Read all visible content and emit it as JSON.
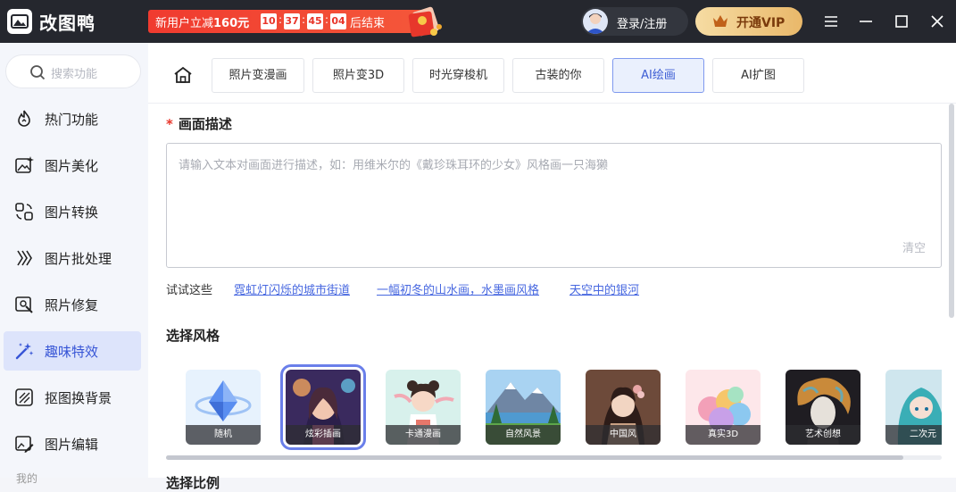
{
  "app": {
    "title": "改图鸭"
  },
  "promo": {
    "prefix": "新用户立减",
    "amount": "160元",
    "countdown": [
      "10",
      "37",
      "45",
      "04"
    ],
    "suffix": "后结束"
  },
  "header": {
    "login_label": "登录/注册",
    "vip_label": "开通VIP"
  },
  "sidebar": {
    "search_placeholder": "搜索功能",
    "items": [
      {
        "label": "热门功能",
        "icon": "flame-icon"
      },
      {
        "label": "图片美化",
        "icon": "image-sparkle-icon"
      },
      {
        "label": "图片转换",
        "icon": "convert-icon"
      },
      {
        "label": "图片批处理",
        "icon": "batch-icon"
      },
      {
        "label": "照片修复",
        "icon": "photo-repair-icon"
      },
      {
        "label": "趣味特效",
        "icon": "magic-wand-icon",
        "active": true
      },
      {
        "label": "抠图换背景",
        "icon": "cutout-icon"
      },
      {
        "label": "图片编辑",
        "icon": "image-edit-icon"
      }
    ],
    "section_label": "我的"
  },
  "tabs": [
    {
      "label": "照片变漫画"
    },
    {
      "label": "照片变3D"
    },
    {
      "label": "时光穿梭机"
    },
    {
      "label": "古装的你"
    },
    {
      "label": "AI绘画",
      "active": true
    },
    {
      "label": "AI扩图"
    }
  ],
  "description": {
    "required_mark": "*",
    "title": "画面描述",
    "placeholder": "请输入文本对画面进行描述，如：用维米尔的《戴珍珠耳环的少女》风格画一只海獭",
    "clear_label": "清空"
  },
  "suggestions": {
    "label": "试试这些",
    "items": [
      "霓虹灯闪烁的城市街道",
      "一幅初冬的山水画，水墨画风格",
      "天空中的银河"
    ]
  },
  "styles": {
    "title": "选择风格",
    "items": [
      {
        "label": "随机"
      },
      {
        "label": "炫彩插画",
        "selected": true
      },
      {
        "label": "卡通漫画"
      },
      {
        "label": "自然风景"
      },
      {
        "label": "中国风"
      },
      {
        "label": "真实3D"
      },
      {
        "label": "艺术创想"
      },
      {
        "label": "二次元"
      }
    ]
  },
  "next_section": {
    "title": "选择比例"
  },
  "colors": {
    "accent": "#3d5ed4",
    "promo_red": "#f03b2f",
    "vip_gold": "#e9b86a",
    "titlebar": "#25272e"
  }
}
